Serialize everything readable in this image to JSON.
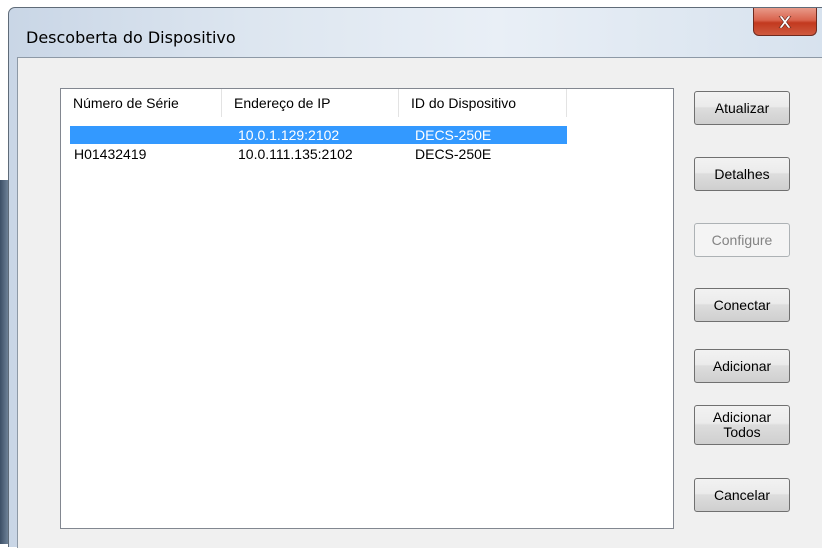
{
  "window": {
    "title": "Descoberta do Dispositivo",
    "close_label": "X"
  },
  "list": {
    "columns": [
      "Número de Série",
      "Endereço de IP",
      "ID do Dispositivo"
    ],
    "rows": [
      {
        "serial": "",
        "ip": "10.0.1.129:2102",
        "device_id": "DECS-250E",
        "selected": true
      },
      {
        "serial": "H01432419",
        "ip": "10.0.111.135:2102",
        "device_id": "DECS-250E",
        "selected": false
      }
    ]
  },
  "buttons": {
    "refresh": "Atualizar",
    "details": "Detalhes",
    "configure": "Configure",
    "connect": "Conectar",
    "add": "Adicionar",
    "add_all_line1": "Adicionar",
    "add_all_line2": "Todos",
    "cancel": "Cancelar"
  },
  "colors": {
    "selection": "#3399ff",
    "close_button": "#c2391f"
  }
}
